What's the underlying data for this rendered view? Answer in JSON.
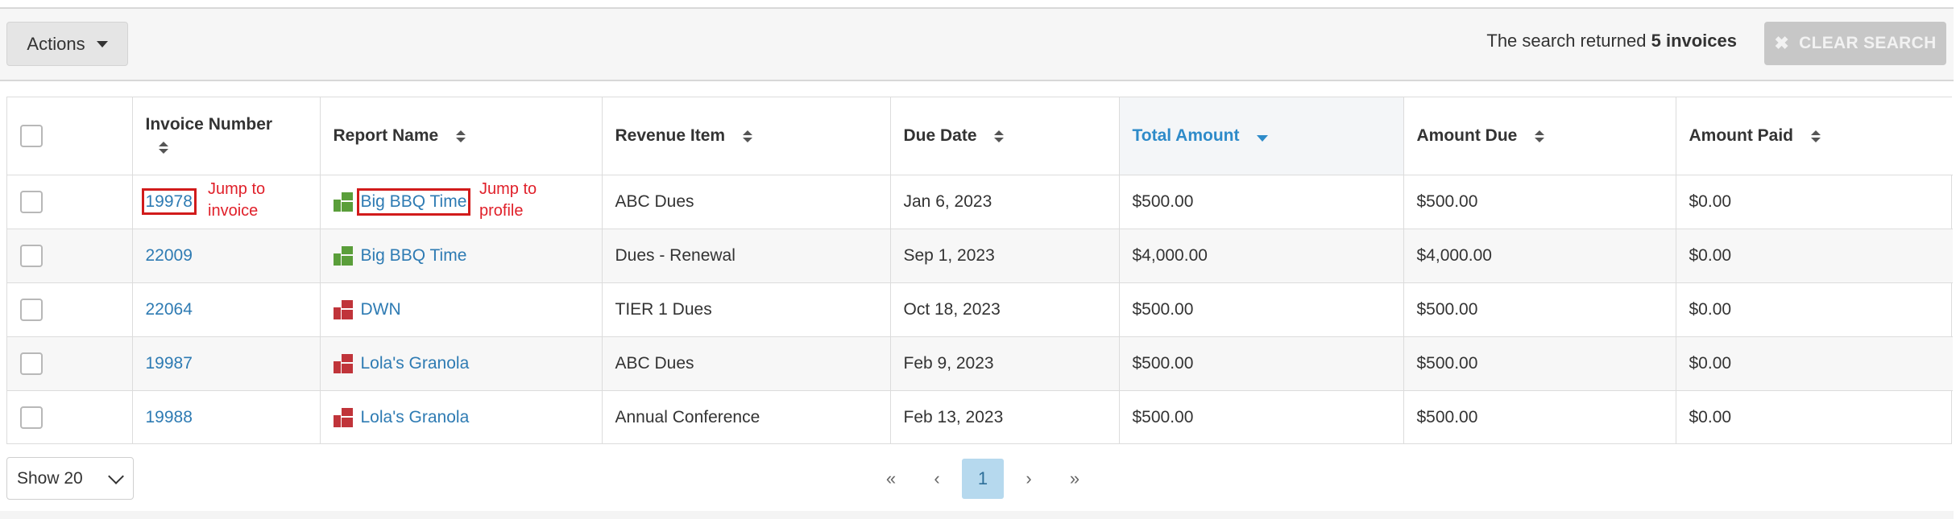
{
  "toolbar": {
    "actions_label": "Actions",
    "search_summary_prefix": "The search returned",
    "search_summary_count": "5 invoices",
    "clear_search_label": "CLEAR SEARCH"
  },
  "table": {
    "columns": [
      "Invoice Number",
      "Report Name",
      "Revenue Item",
      "Due Date",
      "Total Amount",
      "Amount Due",
      "Amount Paid"
    ],
    "sorted_column": "Total Amount",
    "sort_direction": "descending",
    "rows": [
      {
        "invoice": "19978",
        "report": "Big BBQ Time",
        "report_icon_color": "#5a9e3a",
        "revenue": "ABC Dues",
        "due": "Jan 6, 2023",
        "total": "$500.00",
        "amount_due": "$500.00",
        "paid": "$0.00"
      },
      {
        "invoice": "22009",
        "report": "Big BBQ Time",
        "report_icon_color": "#5a9e3a",
        "revenue": "Dues - Renewal",
        "due": "Sep 1, 2023",
        "total": "$4,000.00",
        "amount_due": "$4,000.00",
        "paid": "$0.00"
      },
      {
        "invoice": "22064",
        "report": "DWN",
        "report_icon_color": "#c0343a",
        "revenue": "TIER 1 Dues",
        "due": "Oct 18, 2023",
        "total": "$500.00",
        "amount_due": "$500.00",
        "paid": "$0.00"
      },
      {
        "invoice": "19987",
        "report": "Lola's Granola",
        "report_icon_color": "#c0343a",
        "revenue": "ABC Dues",
        "due": "Feb 9, 2023",
        "total": "$500.00",
        "amount_due": "$500.00",
        "paid": "$0.00"
      },
      {
        "invoice": "19988",
        "report": "Lola's Granola",
        "report_icon_color": "#c0343a",
        "revenue": "Annual Conference",
        "due": "Feb 13, 2023",
        "total": "$500.00",
        "amount_due": "$500.00",
        "paid": "$0.00"
      }
    ]
  },
  "annotations": {
    "jump_invoice_line1": "Jump to",
    "jump_invoice_line2": "invoice",
    "jump_profile_line1": "Jump to",
    "jump_profile_line2": "profile"
  },
  "footer": {
    "page_size_label": "Show 20",
    "pagination": {
      "first": "«",
      "prev": "‹",
      "current": "1",
      "next": "›",
      "last": "»"
    }
  },
  "colors": {
    "link": "#2e7bb3",
    "sorted_header": "#2e8bc9",
    "annotation": "#e0202a",
    "active_page": "#b6d9ee"
  },
  "icons": [
    "caret-down-icon",
    "close-icon",
    "sort-icon",
    "sort-desc-icon",
    "org-blocks-icon",
    "chevron-down-icon"
  ]
}
